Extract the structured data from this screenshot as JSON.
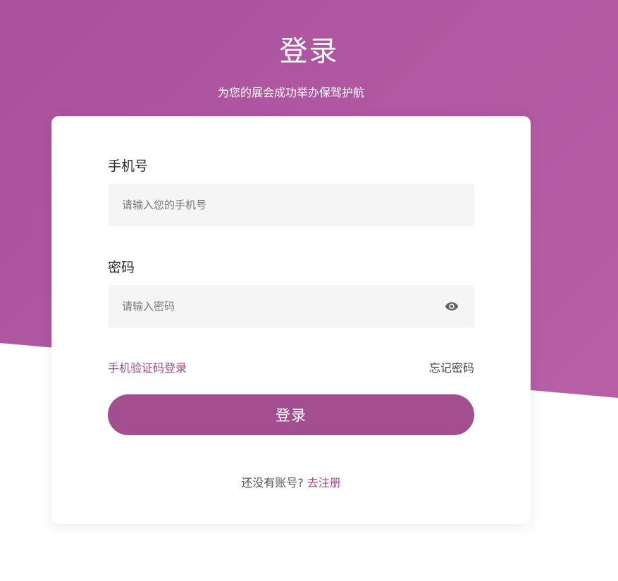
{
  "header": {
    "title": "登录",
    "subtitle": "为您的展会成功举办保驾护航"
  },
  "form": {
    "phone_label": "手机号",
    "phone_placeholder": "请输入您的手机号",
    "password_label": "密码",
    "password_placeholder": "请输入密码",
    "password_toggle_icon": "eye-icon",
    "sms_login_link": "手机验证码登录",
    "forgot_password_link": "忘记密码",
    "login_button": "登录",
    "register_prompt": "还没有账号?",
    "register_link": "去注册"
  },
  "colors": {
    "brand": "#a34f8f",
    "background_band": "#b25ea4",
    "link": "#9b4a8f"
  }
}
